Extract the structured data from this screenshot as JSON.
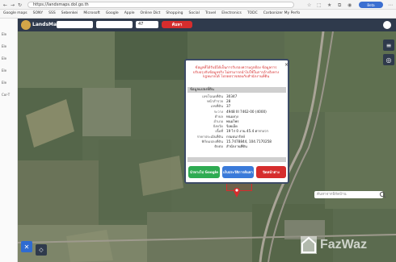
{
  "browser": {
    "url": "https://landsmaps.dol.go.th",
    "profile_button": "Beta",
    "bookmarks": [
      {
        "label": "Google maps"
      },
      {
        "label": "SONY"
      },
      {
        "label": "SSS"
      },
      {
        "label": "Sebenkei"
      },
      {
        "label": "Microsoft"
      },
      {
        "label": "Google"
      },
      {
        "label": "Apple"
      },
      {
        "label": "Online Dict"
      },
      {
        "label": "Shopping"
      },
      {
        "label": "Social"
      },
      {
        "label": "Travel"
      },
      {
        "label": "Electronics"
      },
      {
        "label": "TODC"
      },
      {
        "label": "Carbonizer My Perfo"
      }
    ],
    "side_items": [
      "Ele",
      "Ele",
      "Ele",
      "Ele",
      "Ele",
      "Cor-T"
    ]
  },
  "app": {
    "title": "LandsMaps",
    "field_value": "47",
    "search_button": "ค้นหา",
    "map_search_placeholder": "ค้นหาจากพิกัดบ้าน"
  },
  "popup": {
    "notice": "ข้อมูลที่ได้รับมิได้เป็นการรับรองความถูกต้อง ข้อมูลการปรับปรุงกับข้อมูลจริง ไม่สามารถนำไปใช้ในการอ้างอิงทางกฎหมายได้ โปรดตรวจสอบกับสำนักงานที่ดิน",
    "section_title": "ข้อมูลแปลงที่ดิน",
    "rows": [
      {
        "label": "เลขโฉนดที่ดิน",
        "value": "30347"
      },
      {
        "label": "หน้าสำรวจ",
        "value": "28"
      },
      {
        "label": "เลขที่ดิน",
        "value": "37"
      },
      {
        "label": "ระวาง",
        "value": "4948 III 7462-00 (4000)"
      },
      {
        "label": "ตำบล",
        "value": "หนองกุง"
      },
      {
        "label": "อำเภอ",
        "value": "พนมไพร"
      },
      {
        "label": "จังหวัด",
        "value": "ร้อยเอ็ด"
      },
      {
        "label": "เนื้อที่",
        "value": "19 ไร่ 0 งาน 45.4 ตารางวา"
      },
      {
        "label": "ราคาประเมินที่ดิน",
        "value": "กรมธนารักษ์"
      },
      {
        "label": "พิกัดแปลงที่ดิน",
        "value": "15.7478844, 104.7170258"
      },
      {
        "label": "ติดต่อ",
        "value": "สำนักงานที่ดิน"
      }
    ],
    "btn_google": "นำทางไป Google",
    "btn_share": "เก็บประวัติการค้นหา",
    "btn_close": "ปิดหน้าต่าง"
  },
  "watermark": "FazWaz",
  "colors": {
    "nav": "#2f3a4c",
    "popup_border": "#3c4b66",
    "red": "#d62d2d",
    "green": "#2eab52",
    "blue": "#3a7ad9"
  }
}
